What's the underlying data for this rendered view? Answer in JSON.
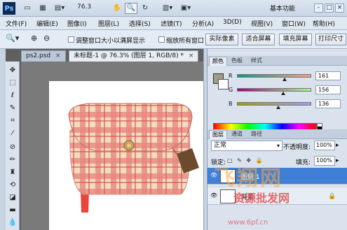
{
  "app": {
    "logo": "Ps",
    "zoom_level": "76.3",
    "workspace": "基本功能",
    "window_controls": [
      "-",
      "□",
      "×"
    ]
  },
  "menu": [
    "文件(F)",
    "编辑(E)",
    "图像(I)",
    "图层(L)",
    "选择(S)",
    "滤镜(T)",
    "分析(A)",
    "3D(D)",
    "视图(V)",
    "窗口(W)",
    "帮助(H)"
  ],
  "options": {
    "resize_windows_label": "调整窗口大小以满屏显示",
    "zoom_all_label": "缩放所有窗口",
    "actual_pixels": "实际像素",
    "fit_screen": "适合屏幕",
    "fill_screen": "填充屏幕",
    "print_size": "打印尺寸"
  },
  "documents": [
    {
      "label": "ps2.psd"
    },
    {
      "label": "未标题-1 @ 76.3% (图层 1, RGB/8) *"
    }
  ],
  "color_panel": {
    "tabs": [
      "颜色",
      "色板",
      "样式"
    ],
    "foreground": "#a19c88",
    "channels": [
      {
        "name": "R",
        "value": "161"
      },
      {
        "name": "G",
        "value": "156"
      },
      {
        "name": "B",
        "value": "136"
      }
    ]
  },
  "layers_panel": {
    "tabs": [
      "图层",
      "通道",
      "路径"
    ],
    "blend_mode": "正常",
    "opacity_label": "不透明度:",
    "opacity_value": "100%",
    "lock_label": "锁定:",
    "fill_label": "填充:",
    "fill_value": "100%",
    "layers": [
      {
        "name": "图层 1",
        "selected": true
      },
      {
        "name": "背景",
        "selected": false
      }
    ]
  },
  "watermark": {
    "line1": "飞翔网",
    "line2": "资源批发网",
    "line3": "www.6pf.cn"
  },
  "colors": {
    "accent": "#3f7fd6",
    "plaid_red": "#e05a4e",
    "plaid_base": "#f3dcc0",
    "strap_red": "#e8463d",
    "tag_brown": "#6b4a2e"
  }
}
